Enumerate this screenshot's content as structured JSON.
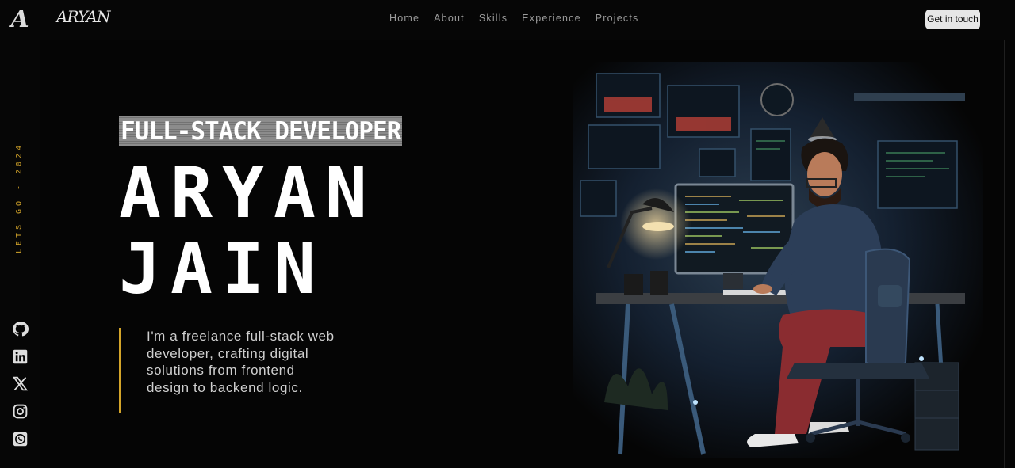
{
  "rail": {
    "vertical_text": "LETS GO - 2024",
    "socials": [
      "github-icon",
      "linkedin-icon",
      "x-icon",
      "instagram-icon",
      "whatsapp-icon"
    ]
  },
  "header": {
    "brand": "ARYAN",
    "nav": [
      "Home",
      "About",
      "Skills",
      "Experience",
      "Projects"
    ],
    "cta": "Get in touch"
  },
  "hero": {
    "subtitle": "FULL-STACK DEVELOPER",
    "name_line1": "ARYAN",
    "name_line2": "JAIN",
    "bio": "I'm a freelance full-stack web developer, crafting digital solutions from frontend design to backend logic."
  },
  "colors": {
    "accent": "#d4a52a",
    "background": "#050505",
    "text": "#ffffff"
  }
}
